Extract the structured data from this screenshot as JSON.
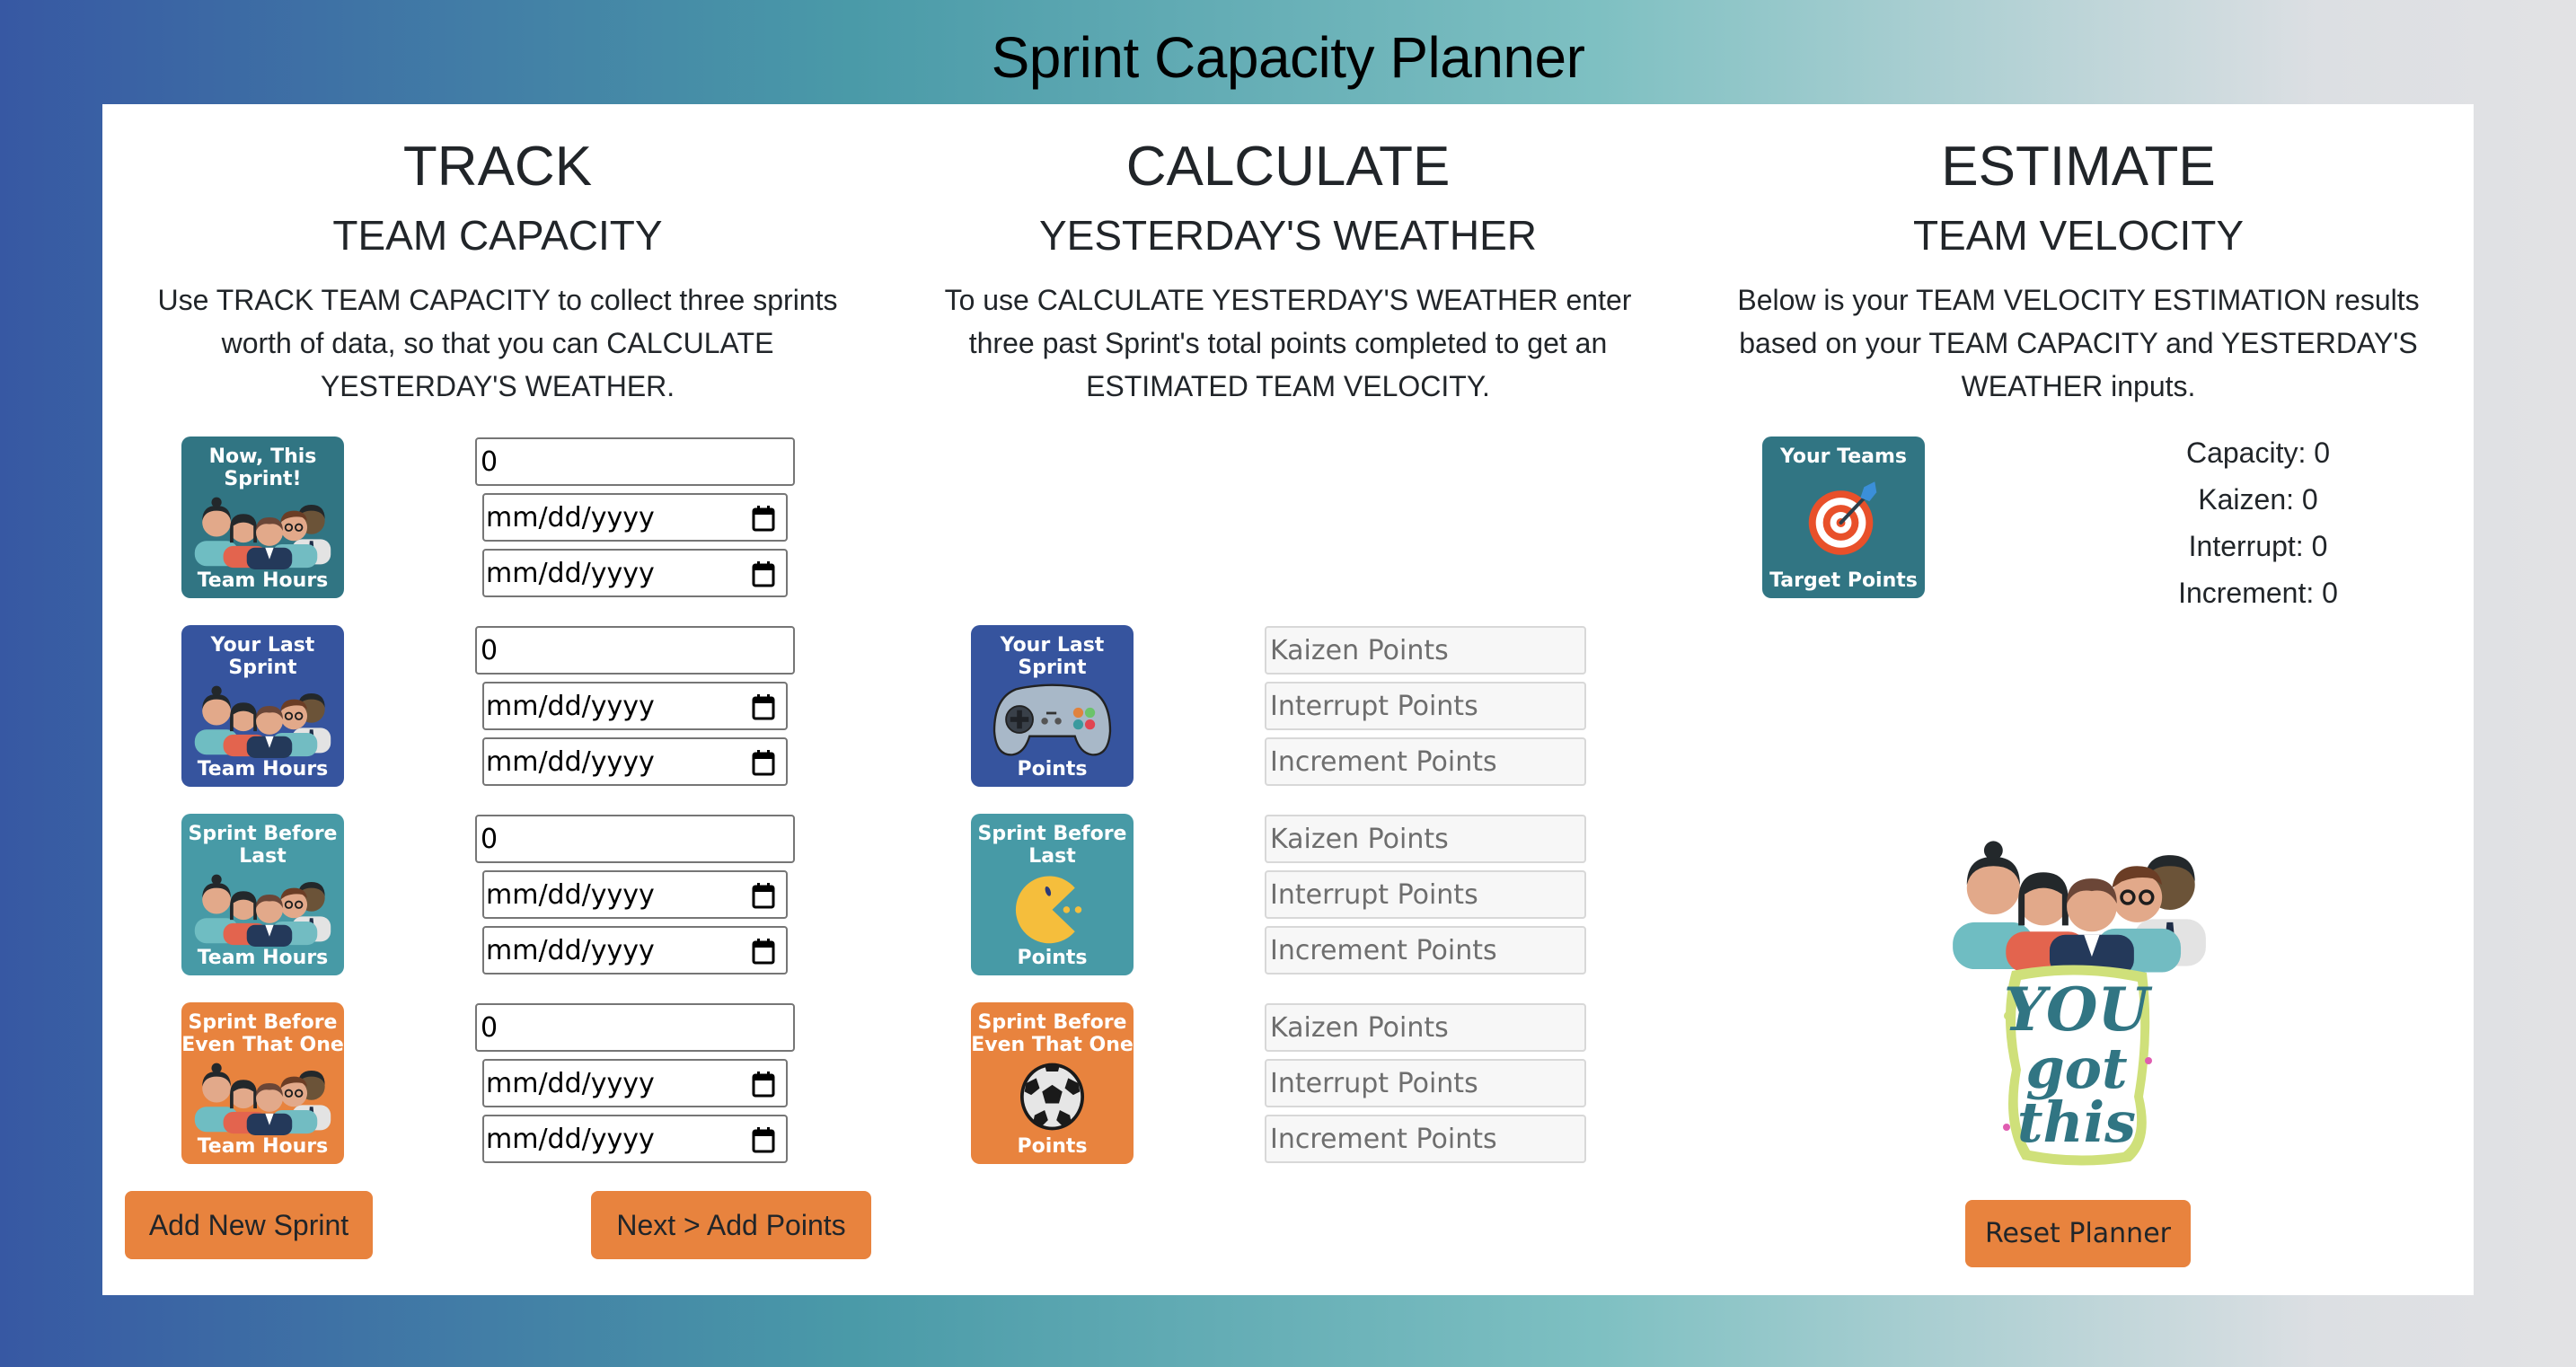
{
  "app": {
    "title": "Sprint Capacity Planner",
    "colors": {
      "accent_orange": "#e8833e",
      "tile_teal_dark": "#317583",
      "tile_blue": "#36549e",
      "tile_teal": "#479aa6",
      "tile_orange": "#e8833e",
      "text": "#212529"
    }
  },
  "track": {
    "heading": "TRACK",
    "subheading": "TEAM CAPACITY",
    "description": "Use TRACK TEAM CAPACITY to collect three sprints worth of data, so that you can CALCULATE YESTERDAY'S WEATHER.",
    "sprints": [
      {
        "tile_top": "Now, This Sprint!",
        "tile_bottom": "Team Hours",
        "tile_icon": "team-people-icon",
        "hours": "0",
        "start_date_placeholder": "mm/dd/yyyy",
        "end_date_placeholder": "mm/dd/yyyy"
      },
      {
        "tile_top": "Your Last Sprint",
        "tile_bottom": "Team Hours",
        "tile_icon": "team-people-icon",
        "hours": "0",
        "start_date_placeholder": "mm/dd/yyyy",
        "end_date_placeholder": "mm/dd/yyyy"
      },
      {
        "tile_top": "Sprint Before Last",
        "tile_bottom": "Team Hours",
        "tile_icon": "team-people-icon",
        "hours": "0",
        "start_date_placeholder": "mm/dd/yyyy",
        "end_date_placeholder": "mm/dd/yyyy"
      },
      {
        "tile_top": "Sprint Before Even That One",
        "tile_bottom": "Team Hours",
        "tile_icon": "team-people-icon",
        "hours": "0",
        "start_date_placeholder": "mm/dd/yyyy",
        "end_date_placeholder": "mm/dd/yyyy"
      }
    ],
    "add_sprint_label": "Add New Sprint",
    "next_label": "Next > Add Points"
  },
  "calculate": {
    "heading": "CALCULATE",
    "subheading": "YESTERDAY'S WEATHER",
    "description": "To use CALCULATE YESTERDAY'S WEATHER enter three past Sprint's total points completed to get an ESTIMATED TEAM VELOCITY.",
    "sprints": [
      {
        "tile_top": "Your Last Sprint",
        "tile_bottom": "Points",
        "tile_icon": "gamepad-icon",
        "kaizen_placeholder": "Kaizen Points",
        "interrupt_placeholder": "Interrupt Points",
        "increment_placeholder": "Increment Points"
      },
      {
        "tile_top": "Sprint Before Last",
        "tile_bottom": "Points",
        "tile_icon": "pacman-icon",
        "kaizen_placeholder": "Kaizen Points",
        "interrupt_placeholder": "Interrupt Points",
        "increment_placeholder": "Increment Points"
      },
      {
        "tile_top": "Sprint Before Even That One",
        "tile_bottom": "Points",
        "tile_icon": "soccer-ball-icon",
        "kaizen_placeholder": "Kaizen Points",
        "interrupt_placeholder": "Interrupt Points",
        "increment_placeholder": "Increment Points"
      }
    ]
  },
  "estimate": {
    "heading": "ESTIMATE",
    "subheading": "TEAM VELOCITY",
    "description": "Below is your TEAM VELOCITY ESTIMATION results based on your TEAM CAPACITY and YESTERDAY'S WEATHER inputs.",
    "tile_top": "Your Teams",
    "tile_bottom": "Target Points",
    "tile_icon": "target-dart-icon",
    "stats": {
      "capacity": "Capacity: 0",
      "kaizen": "Kaizen: 0",
      "interrupt": "Interrupt: 0",
      "increment": "Increment: 0"
    },
    "hero_text_lines": [
      "YOU",
      "got",
      "this"
    ],
    "reset_label": "Reset Planner"
  }
}
